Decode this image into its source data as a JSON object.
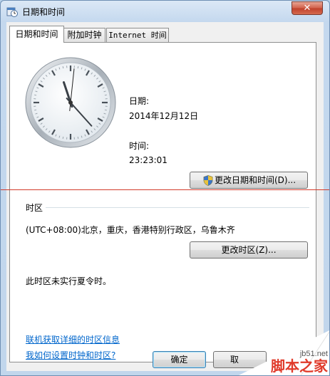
{
  "window": {
    "title": "日期和时间",
    "close_glyph": "✕"
  },
  "tabs": [
    {
      "label": "日期和时间",
      "active": true
    },
    {
      "label": "附加时钟",
      "active": false
    },
    {
      "label": "Internet 时间",
      "active": false
    }
  ],
  "clock": {
    "hour": 23,
    "minute": 23,
    "second": 1
  },
  "date": {
    "label": "日期:",
    "value": "2014年12月12日"
  },
  "time": {
    "label": "时间:",
    "value": "23:23:01"
  },
  "buttons": {
    "change_datetime": "更改日期和时间(D)...",
    "change_timezone": "更改时区(Z)...",
    "ok": "确定",
    "cancel": "取"
  },
  "timezone": {
    "section_label": "时区",
    "value": "(UTC+08:00)北京，重庆，香港特别行政区，乌鲁木齐",
    "dst_note": "此时区未实行夏令时。"
  },
  "links": {
    "online_info": "联机获取详细的时区信息",
    "how_to": "我如何设置时钟和时区?"
  },
  "watermark": {
    "site": "jb51.net",
    "brand": "脚本之家"
  },
  "colors": {
    "link": "#0066cc",
    "watermark": "#e03a2a",
    "panel_bg": "#ffffff"
  }
}
